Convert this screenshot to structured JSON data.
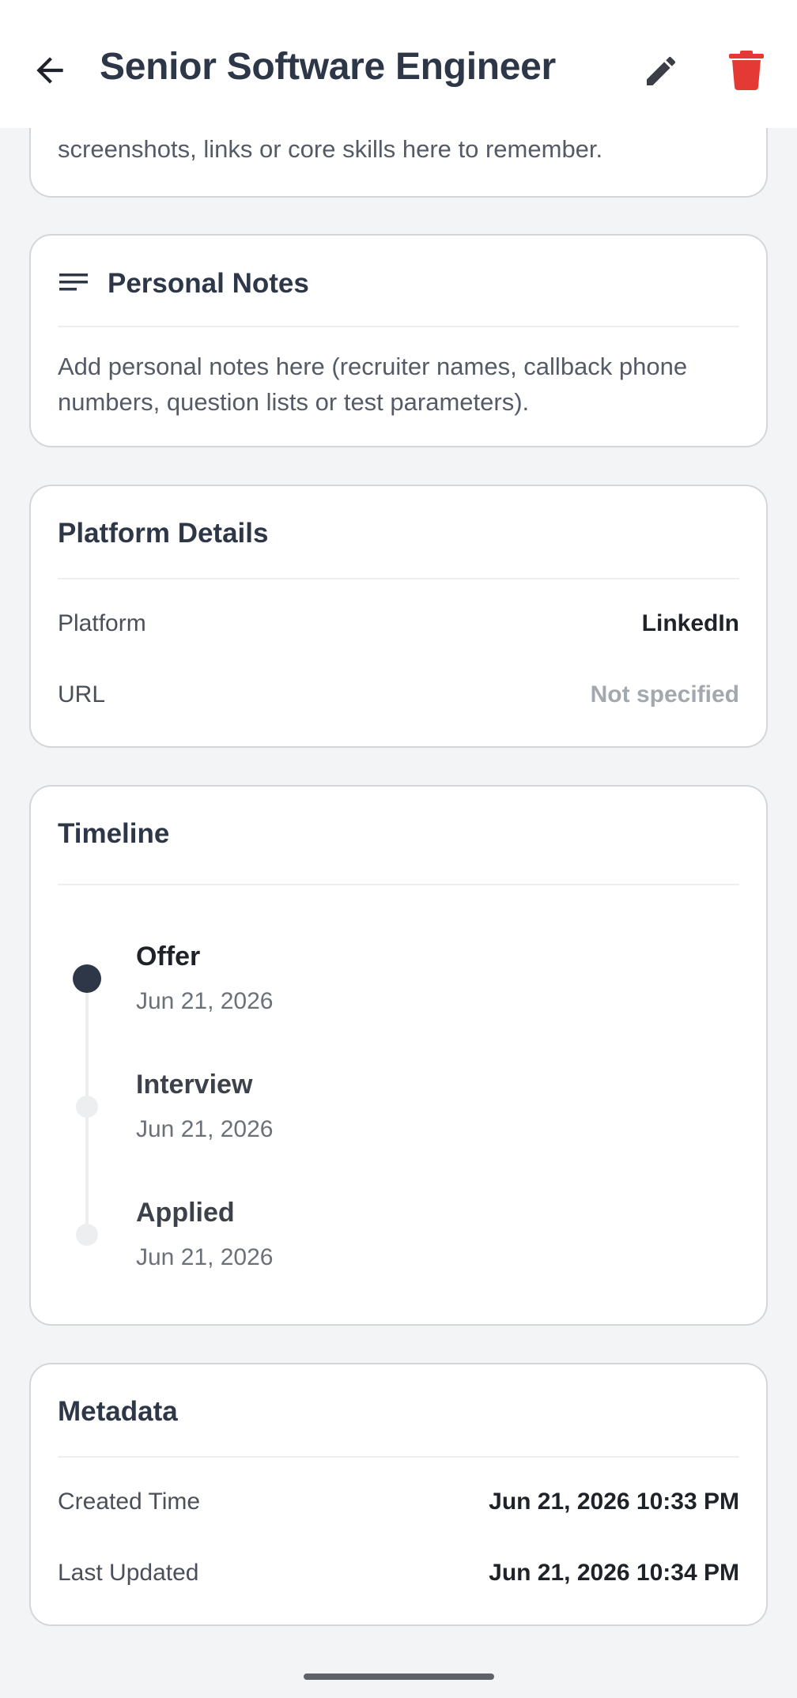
{
  "app_bar": {
    "title": "Senior Software Engineer",
    "back_icon": "arrow-left-icon",
    "edit_icon": "pencil-icon",
    "delete_icon": "trash-icon",
    "delete_color": "#e53935"
  },
  "partial_card": {
    "text": "screenshots, links or core skills here to remember."
  },
  "personal_notes": {
    "icon": "notes-lines-icon",
    "title": "Personal Notes",
    "placeholder": "Add personal notes here (recruiter names, callback phone numbers, question lists or test parameters)."
  },
  "platform_details": {
    "title": "Platform Details",
    "rows": [
      {
        "label": "Platform",
        "value": "LinkedIn"
      },
      {
        "label": "URL",
        "value": "Not specified"
      }
    ]
  },
  "timeline": {
    "title": "Timeline",
    "items": [
      {
        "status": "Offer",
        "date": "Jun 21, 2026",
        "active": true
      },
      {
        "status": "Interview",
        "date": "Jun 21, 2026",
        "active": false
      },
      {
        "status": "Applied",
        "date": "Jun 21, 2026",
        "active": false
      }
    ],
    "active_color": "#2d3748",
    "inactive_color": "#eceef0"
  },
  "metadata": {
    "title": "Metadata",
    "rows": [
      {
        "label": "Created Time",
        "value": "Jun 21, 2026 10:33 PM"
      },
      {
        "label": "Last Updated",
        "value": "Jun 21, 2026 10:34 PM"
      }
    ]
  }
}
